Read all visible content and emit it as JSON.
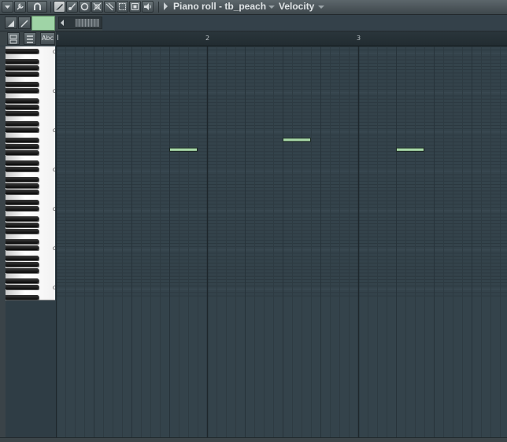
{
  "window": {
    "title": "Piano roll - tb_peach",
    "target_dropdown": "Velocity"
  },
  "toolbar": {
    "buttons": [
      {
        "name": "menu-arrow-icon"
      },
      {
        "name": "wrench-icon"
      },
      {
        "name": "magnet-icon"
      },
      {
        "name": "pencil-icon",
        "active": true
      },
      {
        "name": "paint-brush-icon"
      },
      {
        "name": "delete-icon"
      },
      {
        "name": "mute-icon"
      },
      {
        "name": "slice-icon"
      },
      {
        "name": "select-icon"
      },
      {
        "name": "zoom-icon"
      },
      {
        "name": "playback-icon"
      },
      {
        "name": "speaker-icon"
      }
    ]
  },
  "ruler": {
    "bars": [
      "2",
      "3"
    ]
  },
  "keyboard": {
    "octave_labels": [
      "C8",
      "C7",
      "C6",
      "C5",
      "C4",
      "C3",
      "C2"
    ]
  },
  "notes": [
    {
      "pitch": "G5",
      "bar": 1.75,
      "length_steps": 3
    },
    {
      "pitch": "A#5",
      "bar": 2.5,
      "length_steps": 3
    },
    {
      "pitch": "G5",
      "bar": 3.25,
      "length_steps": 3
    }
  ],
  "colors": {
    "note_fill": "#a8d8a8",
    "swatch": "#9fd4a6",
    "grid_bg": "#34434b"
  }
}
